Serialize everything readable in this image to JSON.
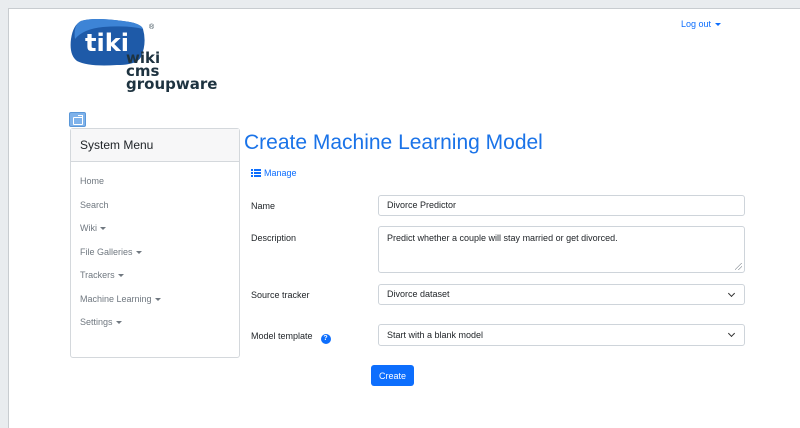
{
  "logo": {
    "mark": "tiki",
    "line1": "wiki",
    "line2": "cms",
    "line3": "groupware",
    "registered": "®",
    "brand_color": "#1e5aa8"
  },
  "header": {
    "logout_label": "Log out"
  },
  "sidebar": {
    "title": "System Menu",
    "items": [
      {
        "label": "Home",
        "has_dropdown": false
      },
      {
        "label": "Search",
        "has_dropdown": false
      },
      {
        "label": "Wiki",
        "has_dropdown": true
      },
      {
        "label": "File Galleries",
        "has_dropdown": true
      },
      {
        "label": "Trackers",
        "has_dropdown": true
      },
      {
        "label": "Machine Learning",
        "has_dropdown": true
      },
      {
        "label": "Settings",
        "has_dropdown": true
      }
    ]
  },
  "main": {
    "title": "Create Machine Learning Model",
    "manage_label": "Manage",
    "form": {
      "name_label": "Name",
      "name_value": "Divorce Predictor",
      "description_label": "Description",
      "description_value": "Predict whether a couple will stay married or get divorced.",
      "source_label": "Source tracker",
      "source_value": "Divorce dataset",
      "template_label": "Model template",
      "template_value": "Start with a blank model",
      "help_glyph": "?",
      "submit_label": "Create"
    }
  },
  "colors": {
    "accent": "#0d6efd",
    "title": "#1a73e8"
  }
}
